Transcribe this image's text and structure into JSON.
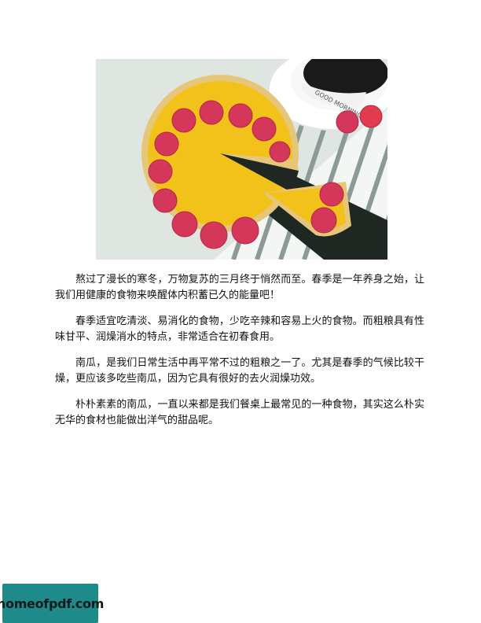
{
  "hero_image": {
    "mug_text": "GOOD MORNING"
  },
  "article": {
    "paragraphs": [
      "熬过了漫长的寒冬，万物复苏的三月终于悄然而至。春季是一年养身之始，让我们用健康的食物来唤醒体内积蓄已久的能量吧！",
      "春季适宜吃清淡、易消化的食物，少吃辛辣和容易上火的食物。而粗粮具有性味甘平、润燥消水的特点，非常适合在初春食用。",
      "南瓜，是我们日常生活中再平常不过的粗粮之一了。尤其是春季的气候比较干燥，更应该多吃些南瓜，因为它具有很好的去火润燥功效。",
      "朴朴素素的南瓜，一直以来都是我们餐桌上最常见的一种食物，其实这么朴实无华的食材也能做出洋气的甜品呢。"
    ]
  },
  "watermark": {
    "text": "homeofpdf.com"
  },
  "colors": {
    "tart_filling": "#f2c21a",
    "crust": "#e6c77a",
    "raspberry": "#d4375a",
    "watermark_bg": "#1f8a8a"
  }
}
